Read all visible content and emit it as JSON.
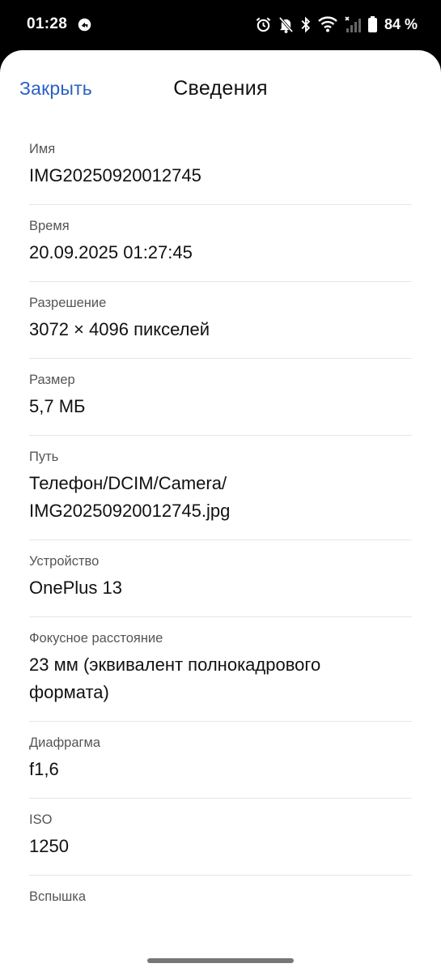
{
  "status_bar": {
    "time": "01:28",
    "battery": "84 %",
    "icons": [
      "navigation-icon",
      "alarm-icon",
      "bell-off-icon",
      "bluetooth-icon",
      "wifi-icon",
      "signal-icon",
      "battery-icon"
    ]
  },
  "header": {
    "close_label": "Закрыть",
    "title": "Сведения"
  },
  "details": [
    {
      "label": "Имя",
      "value": "IMG20250920012745"
    },
    {
      "label": "Время",
      "value": "20.09.2025 01:27:45"
    },
    {
      "label": "Разрешение",
      "value": "3072 × 4096 пикселей"
    },
    {
      "label": "Размер",
      "value": "5,7 МБ"
    },
    {
      "label": "Путь",
      "value": "Телефон/DCIM/Camera/\nIMG20250920012745.jpg"
    },
    {
      "label": "Устройство",
      "value": "OnePlus 13"
    },
    {
      "label": "Фокусное расстояние",
      "value": "23 мм (эквивалент полнокадрового формата)"
    },
    {
      "label": "Диафрагма",
      "value": "f1,6"
    },
    {
      "label": "ISO",
      "value": "1250"
    },
    {
      "label": "Вспышка",
      "value": ""
    }
  ],
  "colors": {
    "accent": "#2a62c4",
    "background": "#ffffff",
    "status_bar": "#000000"
  }
}
